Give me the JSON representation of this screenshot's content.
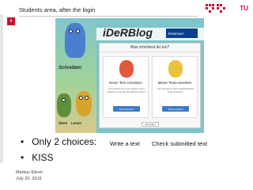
{
  "slide": {
    "title": "Students area, after the login",
    "number": "8",
    "logo_text": "TU"
  },
  "screenshot": {
    "blog_title": "iDeRBlog",
    "erasmus_label": "Erasmus+",
    "art_title": "Schreiben",
    "art_caption_1": "Üben",
    "art_caption_2": "Lesen",
    "panel_heading": "Was möchtest du tun?",
    "card_write": {
      "title": "Einen Text schreiben",
      "text": "Hier kannst du einen eigenen Text schreiben und ihn korrigieren lassen.",
      "button": "Text schreiben"
    },
    "card_check": {
      "title": "Meine Texte ansehen",
      "text": "Hier kannst du deine abgegebenen Texte ansehen.",
      "button": "Texte ansehen"
    },
    "logout": "Abmelden",
    "colors": {
      "background": "#7fc4c9",
      "button": "#3b7bc8",
      "monster_write": "#e4573d",
      "monster_check": "#e8c23a"
    }
  },
  "bullets": [
    {
      "glyph": "•",
      "text": "Only 2 choices:"
    },
    {
      "glyph": "•",
      "text": "KISS"
    }
  ],
  "labels": {
    "write": "Write a text",
    "check": "Check submitted text"
  },
  "footer": {
    "author": "Markus Ebner",
    "date": "July 20, 2016"
  },
  "accent_color": "#c8102e"
}
